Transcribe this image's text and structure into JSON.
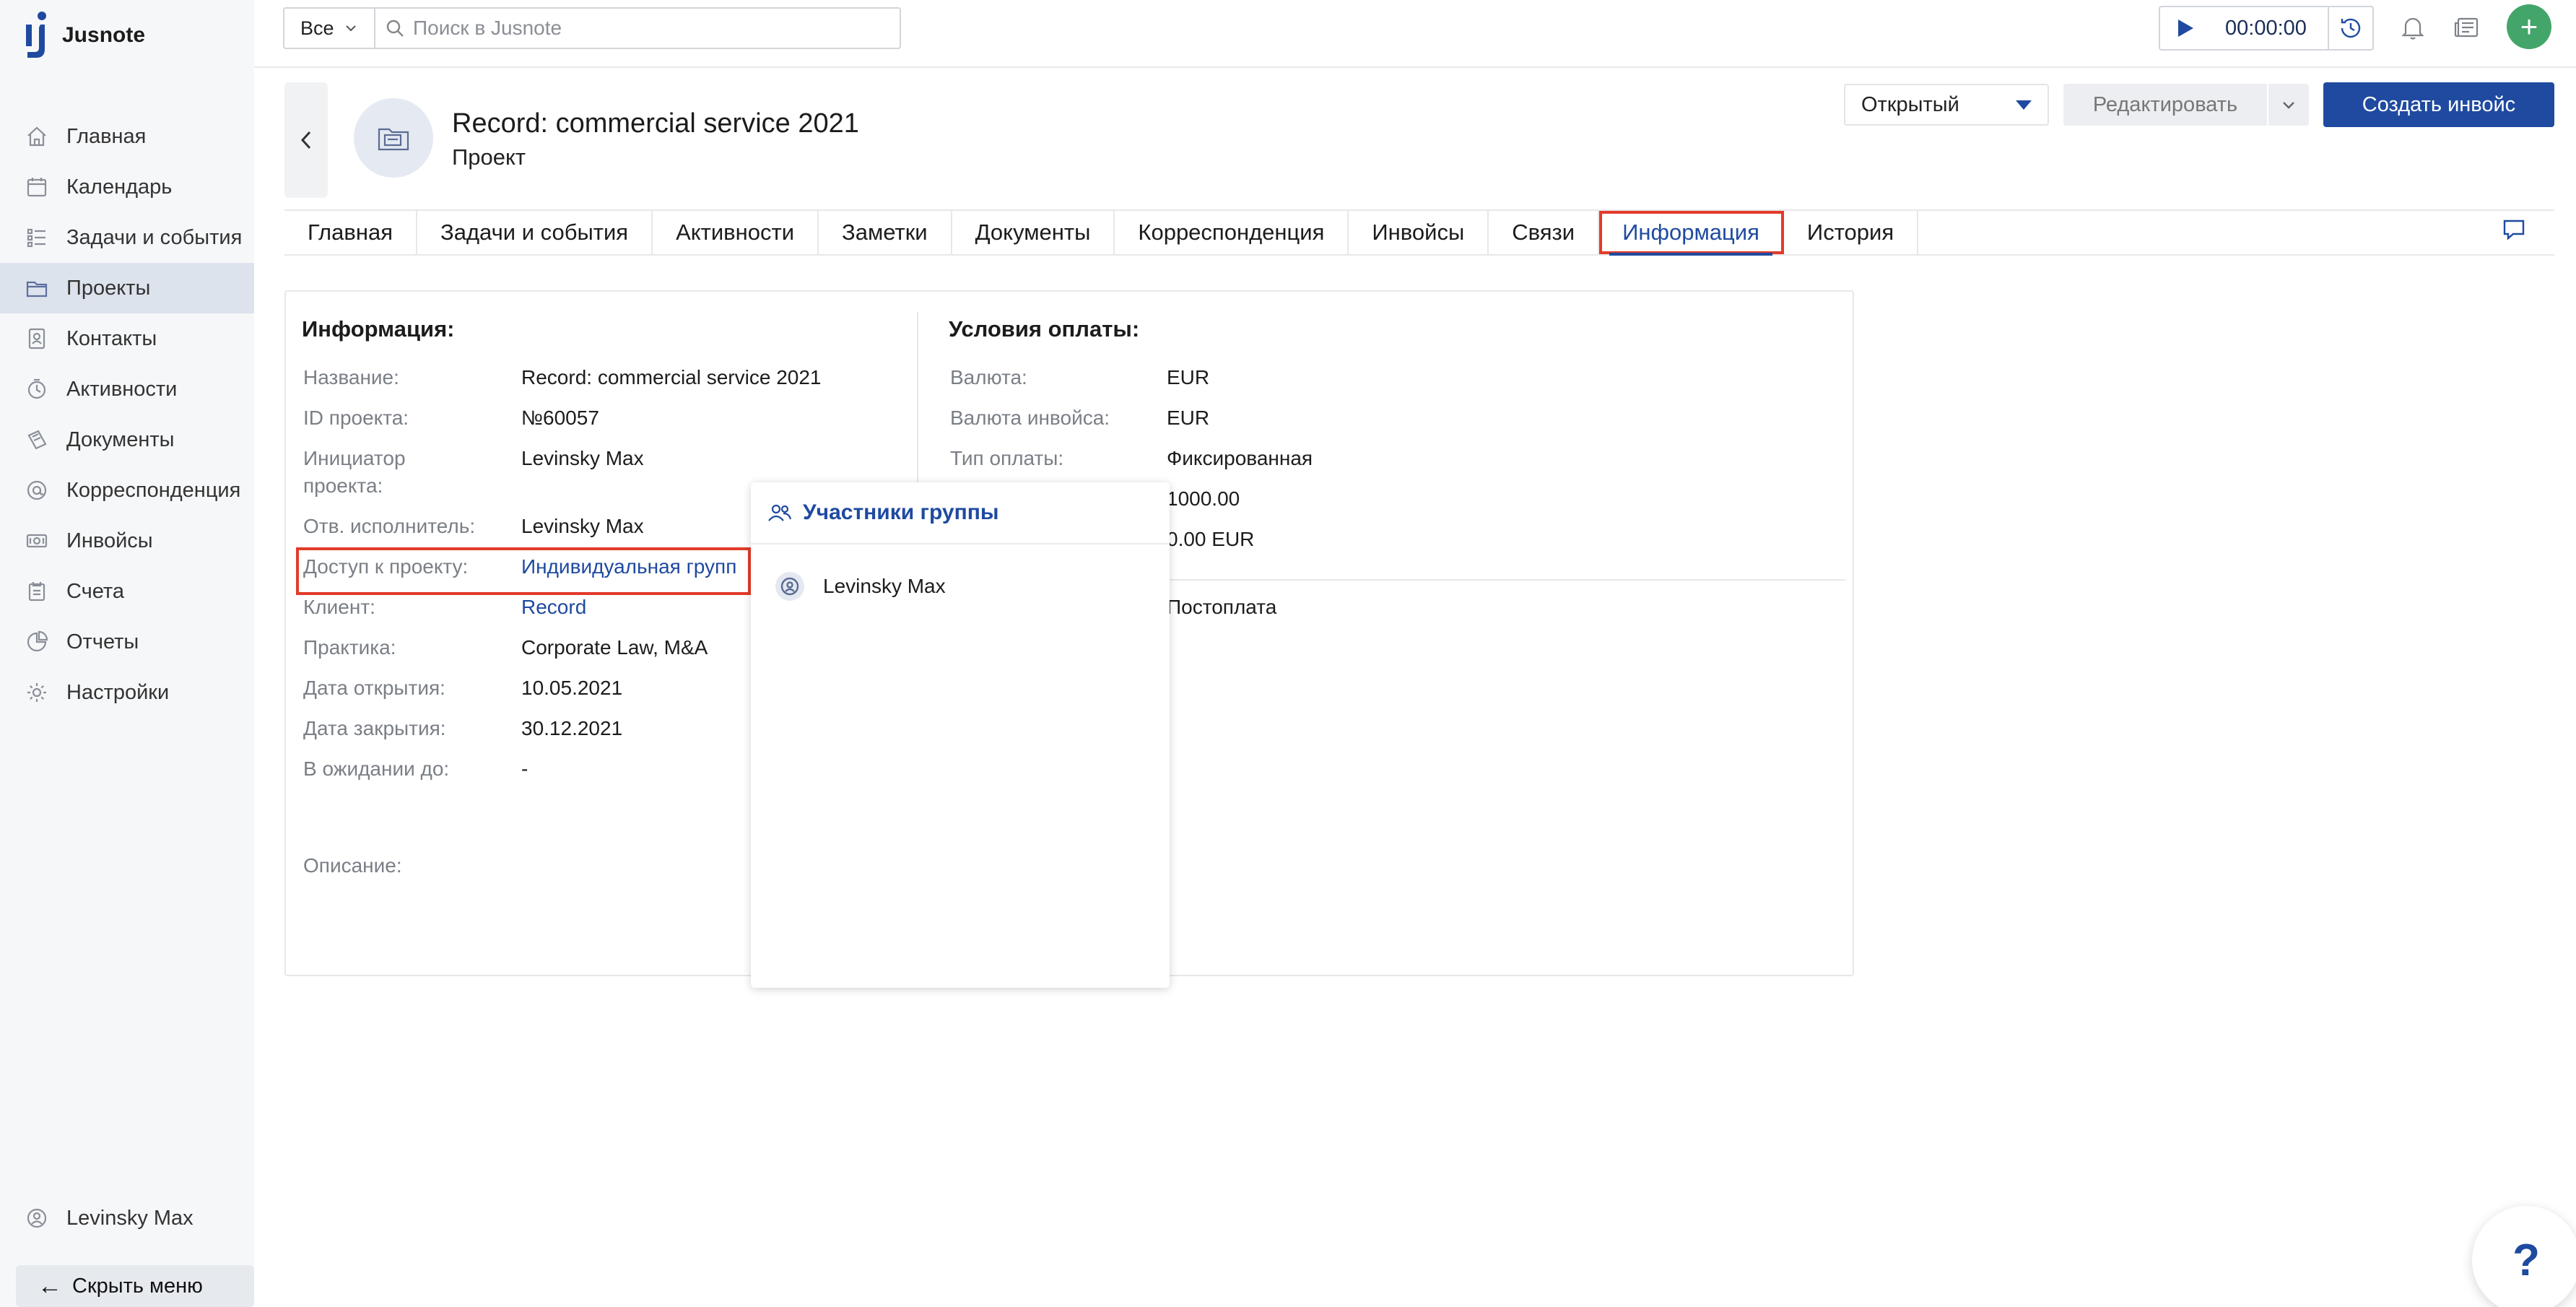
{
  "app": {
    "name": "Jusnote"
  },
  "sidebar": {
    "items": [
      {
        "label": "Главная",
        "icon": "home-icon"
      },
      {
        "label": "Календарь",
        "icon": "calendar-icon"
      },
      {
        "label": "Задачи и события",
        "icon": "tasks-icon"
      },
      {
        "label": "Проекты",
        "icon": "folder-icon",
        "active": true
      },
      {
        "label": "Контакты",
        "icon": "contacts-icon"
      },
      {
        "label": "Активности",
        "icon": "activity-icon"
      },
      {
        "label": "Документы",
        "icon": "documents-icon"
      },
      {
        "label": "Корреспонденция",
        "icon": "mail-icon"
      },
      {
        "label": "Инвойсы",
        "icon": "invoice-icon"
      },
      {
        "label": "Счета",
        "icon": "bills-icon"
      },
      {
        "label": "Отчеты",
        "icon": "reports-icon"
      },
      {
        "label": "Настройки",
        "icon": "settings-icon"
      }
    ],
    "user_name": "Levinsky Max",
    "hide_menu_label": "Скрыть меню"
  },
  "topbar": {
    "scope_value": "Все",
    "search_placeholder": "Поиск в Jusnote",
    "timer_value": "00:00:00",
    "add_label": "+"
  },
  "project": {
    "title": "Record: commercial service 2021",
    "subtitle": "Проект",
    "status": "Открытый",
    "edit_label": "Редактировать",
    "create_invoice_label": "Создать инвойс"
  },
  "tabs": [
    {
      "label": "Главная"
    },
    {
      "label": "Задачи и события"
    },
    {
      "label": "Активности"
    },
    {
      "label": "Заметки"
    },
    {
      "label": "Документы"
    },
    {
      "label": "Корреспонденция"
    },
    {
      "label": "Инвойсы"
    },
    {
      "label": "Связи"
    },
    {
      "label": "Информация",
      "active": true
    },
    {
      "label": "История"
    }
  ],
  "info": {
    "title": "Информация:",
    "fields": [
      {
        "label": "Название:",
        "value": "Record: commercial service 2021"
      },
      {
        "label": "ID проекта:",
        "value": "№60057"
      },
      {
        "label": "Инициатор проекта:",
        "value": "Levinsky Max"
      },
      {
        "label": "Отв. исполнитель:",
        "value": "Levinsky Max"
      },
      {
        "label": "Доступ к проекту:",
        "value": "Индивидуальная групп",
        "link": true
      },
      {
        "label": "Клиент:",
        "value": "Record",
        "link": true
      },
      {
        "label": "Практика:",
        "value": "Corporate Law, M&A"
      },
      {
        "label": "Дата открытия:",
        "value": "10.05.2021"
      },
      {
        "label": "Дата закрытия:",
        "value": "30.12.2021"
      },
      {
        "label": "В ожидании до:",
        "value": "-"
      }
    ],
    "description_label": "Описание:"
  },
  "payment": {
    "title": "Условия оплаты:",
    "fields": [
      {
        "label": "Валюта:",
        "value": "EUR"
      },
      {
        "label": "Валюта инвойса:",
        "value": "EUR"
      },
      {
        "label": "Тип оплаты:",
        "value": "Фиксированная"
      },
      {
        "label": "",
        "value": "1000.00"
      },
      {
        "label": "",
        "value": "0.00 EUR"
      },
      {
        "label": "",
        "value": "Постоплата"
      }
    ]
  },
  "popup": {
    "title": "Участники группы",
    "members": [
      {
        "name": "Levinsky Max"
      }
    ]
  },
  "help_label": "?",
  "colors": {
    "accent": "#1f4aa0",
    "highlight": "#e23b2a",
    "add": "#43a56a"
  }
}
